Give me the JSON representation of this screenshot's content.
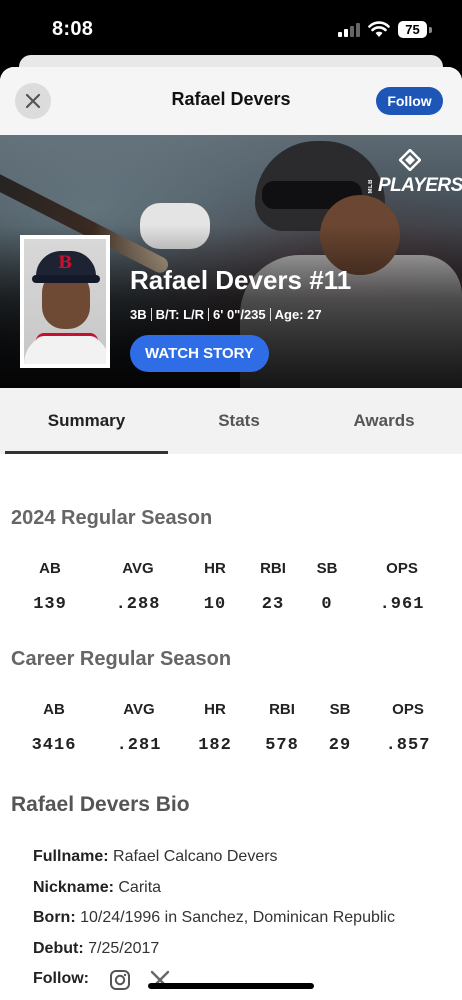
{
  "status_bar": {
    "time": "8:08",
    "battery": "75"
  },
  "header": {
    "title": "Rafael Devers",
    "follow_label": "Follow"
  },
  "hero": {
    "logo_small": "MLB",
    "logo_text": "PLAYERS",
    "player_name": "Rafael Devers #11",
    "position": "3B",
    "bats_throws": "B/T: L/R",
    "height_weight": "6' 0\"/235",
    "age": "Age: 27",
    "watch_label": "WATCH STORY"
  },
  "tabs": [
    {
      "label": "Summary",
      "active": true
    },
    {
      "label": "Stats",
      "active": false
    },
    {
      "label": "Awards",
      "active": false
    }
  ],
  "season": {
    "title": "2024 Regular Season",
    "headers": [
      "AB",
      "AVG",
      "HR",
      "RBI",
      "SB",
      "OPS"
    ],
    "values": [
      "139",
      ".288",
      "10",
      "23",
      "0",
      ".961"
    ]
  },
  "career": {
    "title": "Career Regular Season",
    "headers": [
      "AB",
      "AVG",
      "HR",
      "RBI",
      "SB",
      "OPS"
    ],
    "values": [
      "3416",
      ".281",
      "182",
      "578",
      "29",
      ".857"
    ]
  },
  "bio": {
    "title": "Rafael Devers Bio",
    "fullname_label": "Fullname:",
    "fullname": "Rafael Calcano Devers",
    "nickname_label": "Nickname:",
    "nickname": "Carita",
    "born_label": "Born:",
    "born": "10/24/1996 in Sanchez, Dominican Republic",
    "debut_label": "Debut:",
    "debut": "7/25/2017",
    "follow_label": "Follow:",
    "social_icons": [
      "instagram-icon",
      "x-twitter-icon"
    ]
  },
  "colors": {
    "accent_blue": "#2f6de6",
    "follow_blue": "#1e56b8",
    "red_sox_red": "#c8102e"
  }
}
